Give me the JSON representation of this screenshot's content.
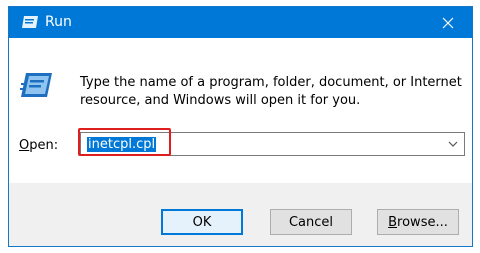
{
  "window": {
    "title": "Run",
    "accent_color": "#0078d7"
  },
  "icons": {
    "title": "run-icon",
    "app": "run-icon",
    "close": "close-icon",
    "dropdown": "chevron-down-icon"
  },
  "dialog": {
    "description": "Type the name of a program, folder, document, or Internet resource, and Windows will open it for you.",
    "open_label_mnemonic": "O",
    "open_label_rest": "pen:",
    "open_value": "inetcpl.cpl"
  },
  "buttons": {
    "ok": "OK",
    "cancel": "Cancel",
    "browse_mnemonic": "B",
    "browse_rest": "rowse..."
  },
  "annotation": {
    "highlight_color": "#e01e1e"
  }
}
